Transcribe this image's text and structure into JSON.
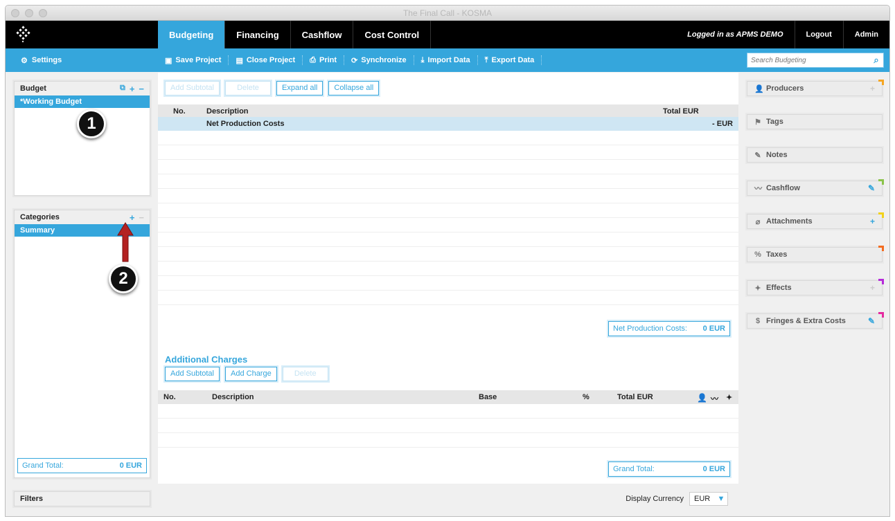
{
  "window": {
    "title": "The Final Call - KOSMA"
  },
  "nav": {
    "tabs": [
      {
        "label": "Budgeting",
        "active": true
      },
      {
        "label": "Financing"
      },
      {
        "label": "Cashflow"
      },
      {
        "label": "Cost Control"
      }
    ],
    "logged_in": "Logged in as APMS DEMO",
    "logout": "Logout",
    "admin": "Admin"
  },
  "toolbar": {
    "settings": "Settings",
    "save": "Save Project",
    "close": "Close Project",
    "print": "Print",
    "sync": "Synchronize",
    "import": "Import Data",
    "export": "Export Data",
    "search_placeholder": "Search Budgeting"
  },
  "budget_panel": {
    "title": "Budget",
    "selected": "*Working Budget"
  },
  "categories_panel": {
    "title": "Categories",
    "selected": "Summary",
    "grand_total_label": "Grand Total:",
    "grand_total_value": "0 EUR"
  },
  "filters": {
    "label": "Filters"
  },
  "main": {
    "buttons": {
      "add_subtotal": "Add Subtotal",
      "delete": "Delete",
      "expand_all": "Expand all",
      "collapse_all": "Collapse all"
    },
    "columns": {
      "no": "No.",
      "description": "Description",
      "total": "Total EUR"
    },
    "row": {
      "description": "Net Production Costs",
      "total": "- EUR"
    },
    "net_total_label": "Net Production Costs:",
    "net_total_value": "0 EUR"
  },
  "additional": {
    "title": "Additional Charges",
    "buttons": {
      "add_subtotal": "Add Subtotal",
      "add_charge": "Add Charge",
      "delete": "Delete"
    },
    "columns": {
      "no": "No.",
      "description": "Description",
      "base": "Base",
      "percent": "%",
      "total": "Total EUR"
    },
    "grand_total_label": "Grand Total:",
    "grand_total_value": "0 EUR"
  },
  "display_currency": {
    "label": "Display Currency",
    "value": "EUR"
  },
  "right_panels": [
    {
      "label": "Producers",
      "icon": "person-icon",
      "action": "+",
      "action_active": false,
      "corner": "#f5a623"
    },
    {
      "label": "Tags",
      "icon": "flag-icon",
      "action": "",
      "action_active": false,
      "corner": ""
    },
    {
      "label": "Notes",
      "icon": "pencil-icon",
      "action": "",
      "action_active": false,
      "corner": ""
    },
    {
      "label": "Cashflow",
      "icon": "trend-icon",
      "action": "✎",
      "action_active": true,
      "corner": "#8bc34a"
    },
    {
      "label": "Attachments",
      "icon": "paperclip-icon",
      "action": "+",
      "action_active": true,
      "corner": "#f2d21b"
    },
    {
      "label": "Taxes",
      "icon": "percent-icon",
      "action": "",
      "action_active": false,
      "corner": "#f36c21"
    },
    {
      "label": "Effects",
      "icon": "sparkle-icon",
      "action": "+",
      "action_active": false,
      "corner": "#b52bd9"
    },
    {
      "label": "Fringes & Extra Costs",
      "icon": "dollar-icon",
      "action": "✎",
      "action_active": true,
      "corner": "#e52ba0"
    }
  ],
  "callouts": [
    "1",
    "2"
  ],
  "colors": {
    "accent": "#35a6dc",
    "nav_bg": "#000000",
    "annotation_arrow": "#b32222"
  }
}
